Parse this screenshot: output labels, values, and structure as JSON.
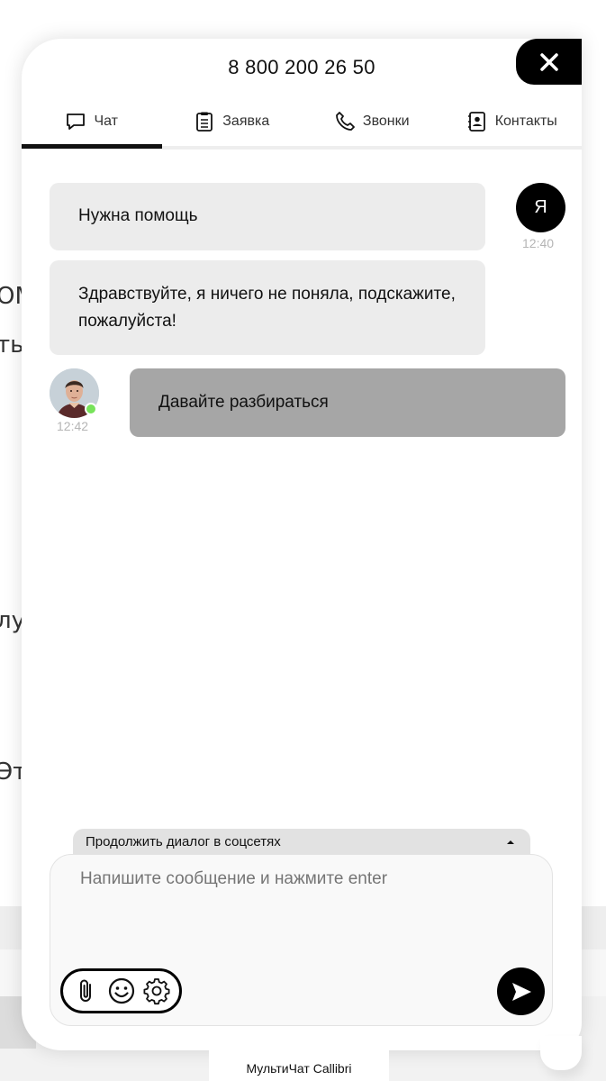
{
  "background": {
    "fragments": [
      "OM",
      "ть",
      "лу",
      "Эт"
    ]
  },
  "header": {
    "phone": "8 800 200 26 50",
    "close_icon": "close-icon"
  },
  "tabs": [
    {
      "label": "Чат",
      "icon": "chat-bubble-icon",
      "active": true
    },
    {
      "label": "Заявка",
      "icon": "clipboard-icon",
      "active": false
    },
    {
      "label": "Звонки",
      "icon": "phone-icon",
      "active": false
    },
    {
      "label": "Контакты",
      "icon": "contacts-book-icon",
      "active": false
    }
  ],
  "messages": [
    {
      "from": "user",
      "text": "Нужна помощь"
    },
    {
      "from": "user",
      "text": "Здравствуйте, я ничего не поняла, подскажите, пожалуйста!"
    },
    {
      "from": "operator",
      "text": "Давайте разбираться"
    }
  ],
  "user": {
    "avatar_letter": "Я",
    "time": "12:40"
  },
  "operator": {
    "time": "12:42",
    "status": "online"
  },
  "social": {
    "label": "Продолжить диалог в соцсетях"
  },
  "composer": {
    "placeholder": "Напишите сообщение и нажмите enter"
  },
  "footer": {
    "label": "МультиЧат Callibri"
  },
  "colors": {
    "accent": "#000000",
    "bubble_user": "#ececec",
    "bubble_operator": "#a6a6a6",
    "online": "#77e35a",
    "time": "#b5b5b5"
  }
}
